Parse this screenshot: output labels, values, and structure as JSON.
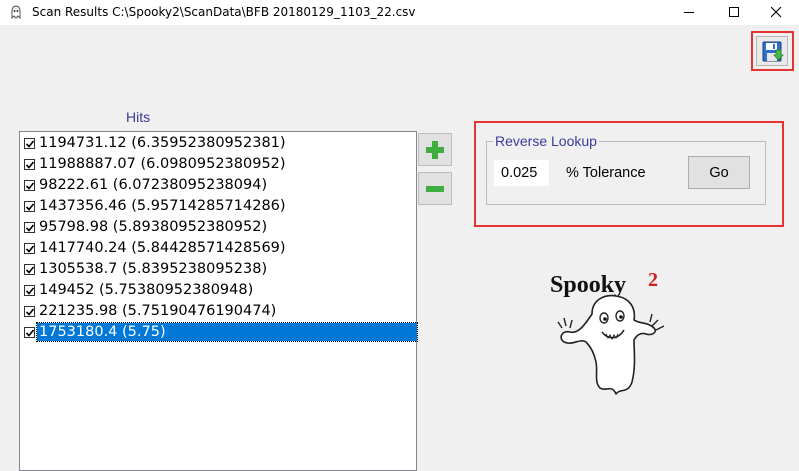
{
  "window": {
    "title": "Scan Results C:\\Spooky2\\ScanData\\BFB 20180129_1103_22.csv",
    "controls": [
      "minimize-icon",
      "maximize-icon",
      "close-icon"
    ]
  },
  "toolbar": {
    "save_icon": "floppy-save-icon"
  },
  "hits": {
    "label": "Hits",
    "items": [
      {
        "text": "1194731.12  (6.35952380952381)",
        "checked": true,
        "selected": false
      },
      {
        "text": "11988887.07  (6.0980952380952)",
        "checked": true,
        "selected": false
      },
      {
        "text": "98222.61  (6.07238095238094)",
        "checked": true,
        "selected": false
      },
      {
        "text": "1437356.46  (5.95714285714286)",
        "checked": true,
        "selected": false
      },
      {
        "text": "95798.98  (5.89380952380952)",
        "checked": true,
        "selected": false
      },
      {
        "text": "1417740.24  (5.84428571428569)",
        "checked": true,
        "selected": false
      },
      {
        "text": "1305538.7  (5.8395238095238)",
        "checked": true,
        "selected": false
      },
      {
        "text": "149452  (5.75380952380948)",
        "checked": true,
        "selected": false
      },
      {
        "text": "221235.98  (5.75190476190474)",
        "checked": true,
        "selected": false
      },
      {
        "text": "1753180.4  (5.75)",
        "checked": true,
        "selected": true
      }
    ],
    "add_icon": "plus-icon",
    "remove_icon": "minus-icon"
  },
  "reverse_lookup": {
    "title": "Reverse Lookup",
    "tolerance_value": "0.025",
    "tolerance_label": "% Tolerance",
    "go_label": "Go"
  },
  "logo": {
    "text": "Spooky",
    "superscript": "2",
    "image": "ghost-mascot-logo"
  },
  "colors": {
    "accent_label": "#3b3b9a",
    "selection": "#0078d7",
    "highlight_frame": "#e53333",
    "plus_green": "#3fae3f",
    "logo_red": "#d42020"
  }
}
